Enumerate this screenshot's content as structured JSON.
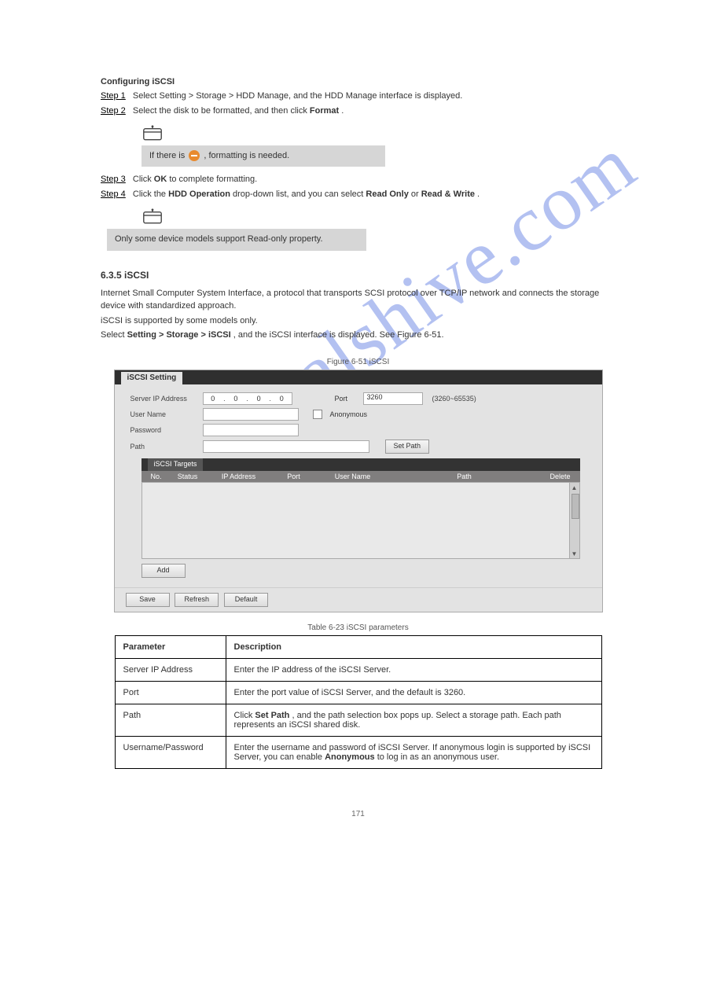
{
  "watermark": "manualshive.com",
  "steps": {
    "step1_label": "Step 1",
    "step1_text": "Select Setting > Storage > HDD Manage, and the HDD Manage interface is displayed.",
    "step2_label": "Step 2",
    "step2_text_prefix": "Select the disk to be formatted, and then click ",
    "step2_bold": "Format",
    "step2_text_suffix": ".",
    "step3_label": "Step 3",
    "step3_text_prefix": "Click ",
    "step3_bold": "OK",
    "step3_text_suffix": " to complete formatting.",
    "step4_label": "Step 4",
    "step4_text_prefix": "Click the ",
    "step4_bold": "HDD Operation",
    "step4_text_mid": " drop-down list, and you can select ",
    "step4_bold2": "Read Only",
    "step4_or": " or ",
    "step4_bold3": "Read & Write",
    "step4_text_suffix": "."
  },
  "notes": {
    "note1_text_prefix": "If there is ",
    "note1_text_suffix": ", formatting is needed.",
    "note2_text": "Only some device models support Read-only property."
  },
  "sections": {
    "heading": "6.3.5 iSCSI",
    "intro1": "Internet Small Computer System Interface, a protocol that transports SCSI protocol over TCP/IP network and connects the storage device with standardized approach.",
    "intro2": "iSCSI is supported by some models only.",
    "intro3_prefix": "Select ",
    "intro3_bold": "Setting > Storage > iSCSI",
    "intro3_suffix": ", and the iSCSI interface is displayed. See Figure 6-51.",
    "figure_caption": "Figure 6-51 iSCSI",
    "config_sub": "Configuring iSCSI",
    "table_caption": "Table 6-23 iSCSI parameters"
  },
  "iscsi_panel": {
    "tab": "iSCSI Setting",
    "server_ip_label": "Server IP Address",
    "ip_a": "0",
    "ip_b": "0",
    "ip_c": "0",
    "ip_d": "0",
    "port_label": "Port",
    "port_value": "3260",
    "port_range": "(3260~65535)",
    "username_label": "User Name",
    "anonymous_label": "Anonymous",
    "password_label": "Password",
    "path_label": "Path",
    "set_path_btn": "Set Path",
    "targets_tab": "iSCSI Targets",
    "cols": {
      "no": "No.",
      "status": "Status",
      "ip": "IP Address",
      "port": "Port",
      "user": "User Name",
      "path": "Path",
      "delete": "Delete"
    },
    "add_btn": "Add",
    "save_btn": "Save",
    "refresh_btn": "Refresh",
    "default_btn": "Default"
  },
  "param_table": {
    "h_param": "Parameter",
    "h_desc": "Description",
    "rows": [
      {
        "param": "Server IP Address",
        "desc": "Enter the IP address of the iSCSI Server."
      },
      {
        "param": "Port",
        "desc": "Enter the port value of iSCSI Server, and the default is 3260."
      },
      {
        "param": "Path",
        "desc_prefix": "Click ",
        "desc_bold": "Set Path",
        "desc_suffix": ", and the path selection box pops up. Select a storage path. Each path represents an iSCSI shared disk."
      },
      {
        "param": "Username/Password",
        "desc_prefix": "Enter the username and password of iSCSI Server. If anonymous login is supported by iSCSI Server, you can enable ",
        "desc_bold": "Anonymous",
        "desc_suffix": " to log in as an anonymous user."
      }
    ]
  },
  "page_number": "171"
}
